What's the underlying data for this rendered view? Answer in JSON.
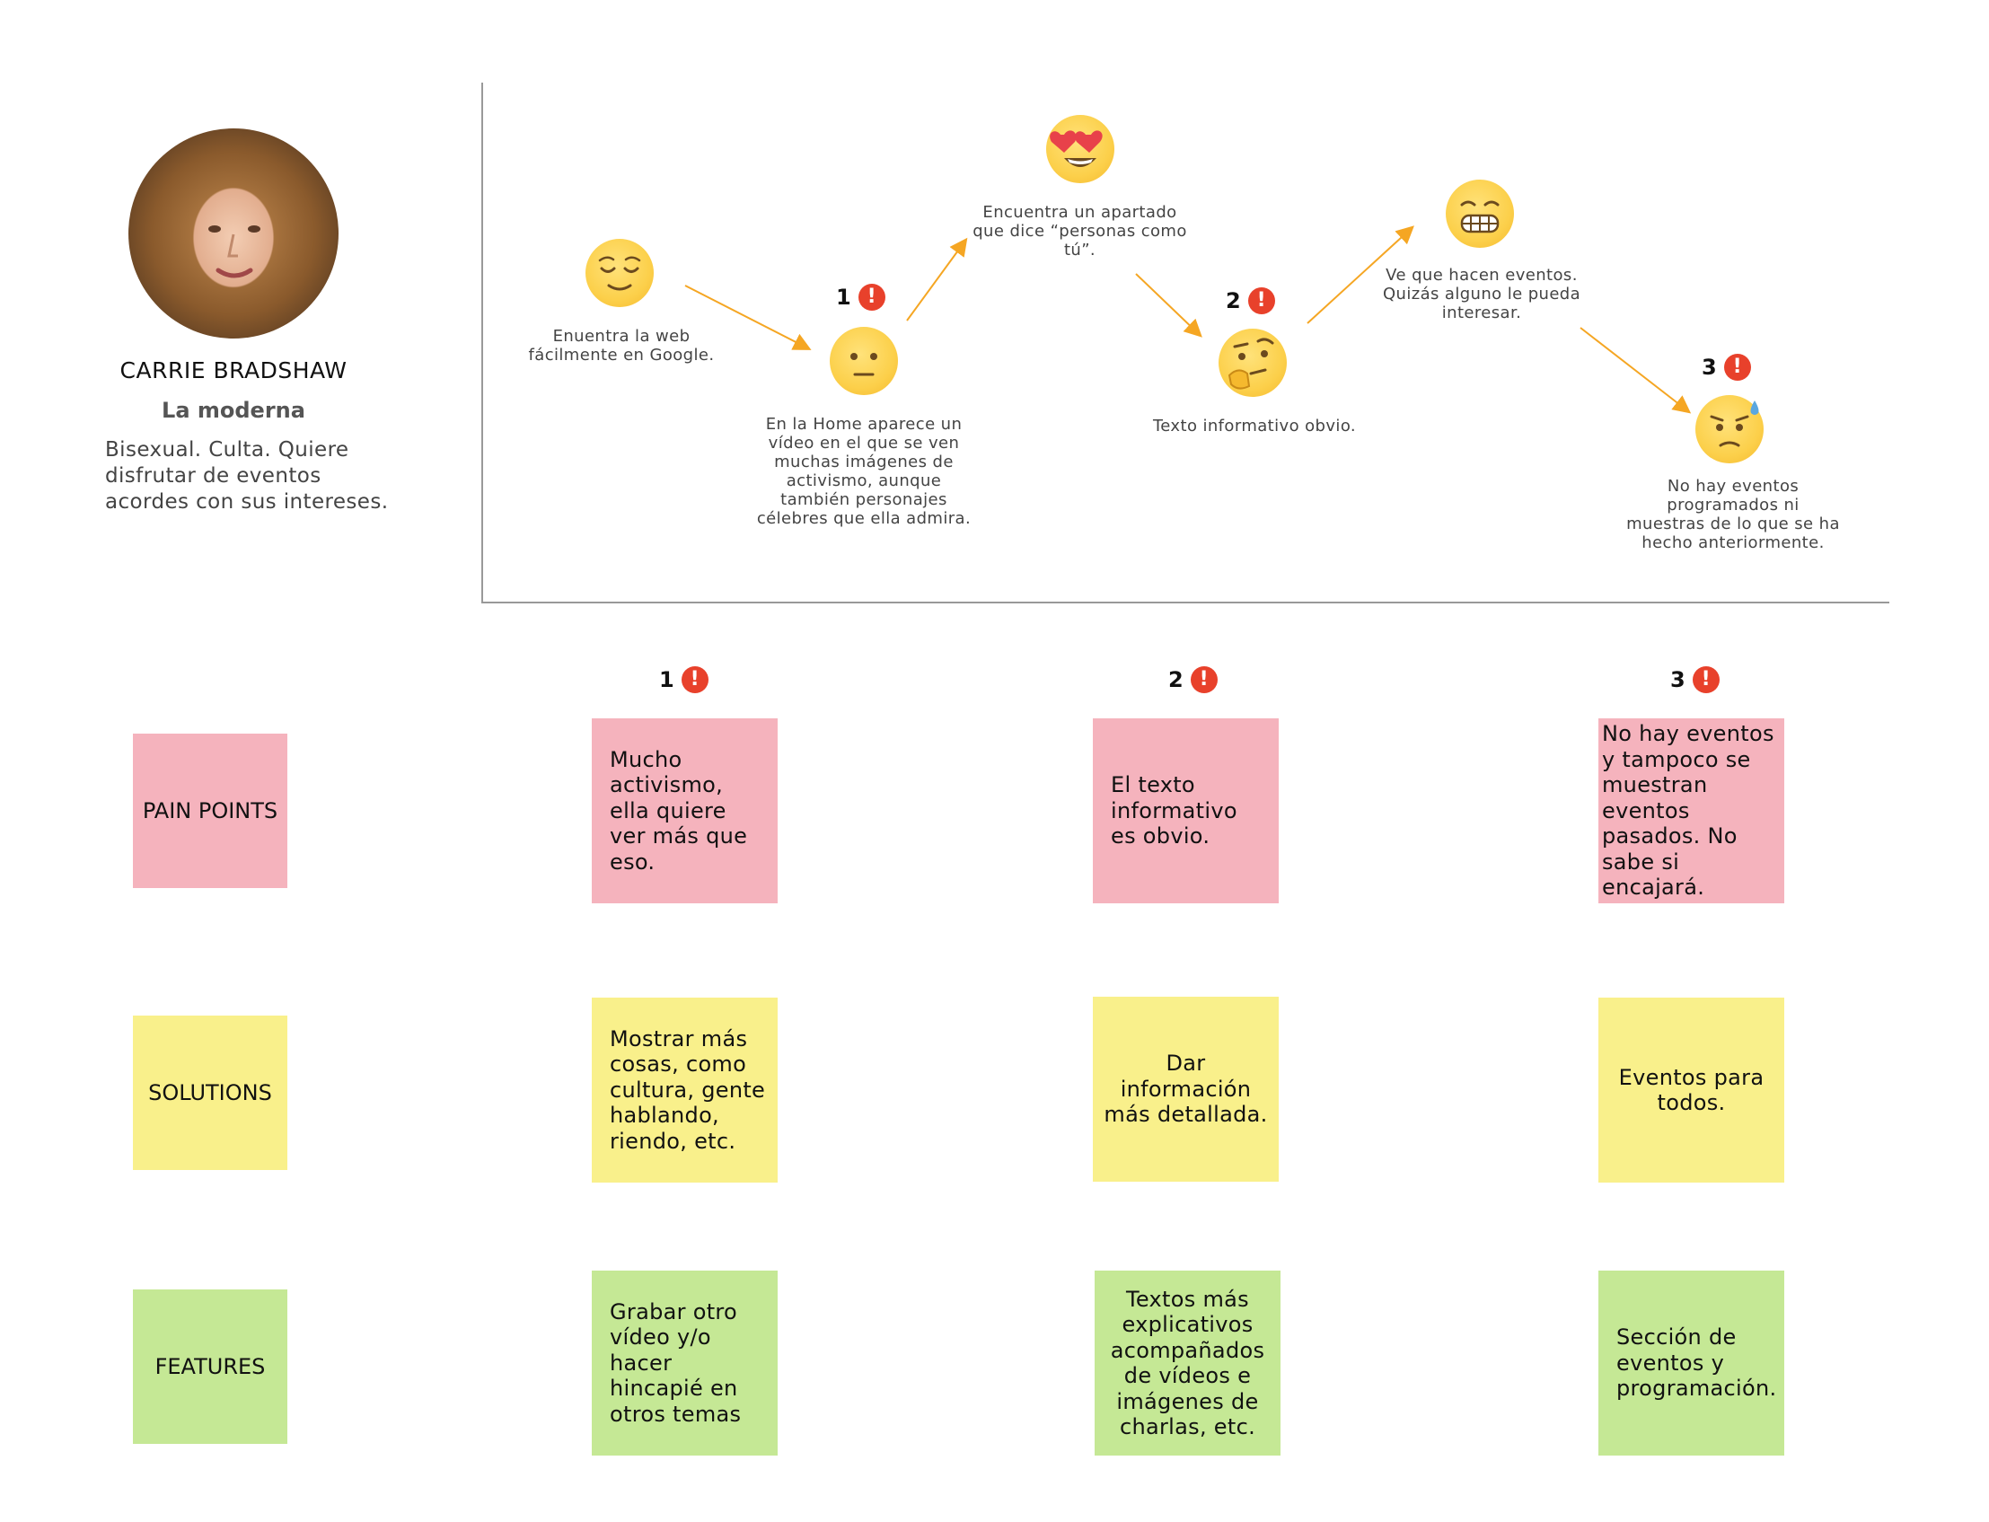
{
  "persona": {
    "name": "CARRIE BRADSHAW",
    "role": "La moderna",
    "description": "Bisexual. Culta. Quiere disfrutar de eventos acordes con sus intereses."
  },
  "journey": {
    "steps": [
      {
        "emotion": "relieved-face",
        "text": "Enuentra la web fácilmente en Google."
      },
      {
        "emotion": "neutral-face",
        "text": "En la Home aparece un vídeo en el que se ven muchas imágenes de activismo, aunque también personajes célebres que ella admira."
      },
      {
        "emotion": "heart-eyes-face",
        "text": "Encuentra un apartado que dice “personas como tú”."
      },
      {
        "emotion": "thinking-face",
        "text": "Texto informativo obvio."
      },
      {
        "emotion": "grimacing-face",
        "text": "Ve que hacen eventos. Quizás alguno le pueda interesar."
      },
      {
        "emotion": "sweat-face",
        "text": "No hay eventos programados ni muestras de lo que se ha hecho anteriormente."
      }
    ],
    "alerts": [
      "1",
      "2",
      "3"
    ],
    "alert_symbol": "!"
  },
  "columns": [
    "1",
    "2",
    "3"
  ],
  "rows": {
    "pain_points": {
      "label": "PAIN POINTS",
      "notes": [
        "Mucho activismo, ella quiere ver más que eso.",
        "El texto informativo es obvio.",
        "No hay eventos y tampoco se muestran eventos pasados. No sabe si encajará."
      ]
    },
    "solutions": {
      "label": "SOLUTIONS",
      "notes": [
        "Mostrar más cosas, como cultura, gente hablando, riendo, etc.",
        "Dar información más detallada.",
        "Eventos para todos."
      ]
    },
    "features": {
      "label": "FEATURES",
      "notes": [
        "Grabar otro vídeo y/o hacer hincapié en otros temas",
        "Textos más explicativos acompañados de vídeos e imágenes de charlas, etc.",
        "Sección de eventos y programación."
      ]
    }
  },
  "colors": {
    "pain": "#f5b3bd",
    "solution": "#f9f08b",
    "feature": "#c5e895",
    "alert": "#e8412b",
    "arrow": "#f5a623"
  }
}
